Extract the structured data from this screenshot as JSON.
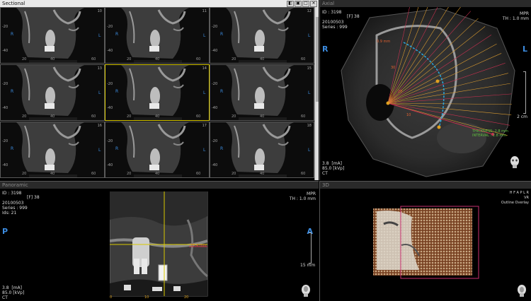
{
  "sectional": {
    "title": "Sectional",
    "win_buttons": [
      "◧",
      "▣",
      "□",
      "✕"
    ],
    "side_letter_r": "R",
    "side_letter_l": "L",
    "ticks_y": [
      "-20",
      "-40"
    ],
    "ticks_x": [
      "20",
      "40",
      "60"
    ],
    "cell_numbers": [
      "10",
      "11",
      "12",
      "13",
      "14",
      "15",
      "16",
      "17",
      "18"
    ]
  },
  "axial": {
    "title": "Axial",
    "id_line": "ID : 3198",
    "f_line": "[F] 38",
    "date": "20100503",
    "series": "Series : 999",
    "mode": "MPR",
    "th": "TH : 1.0 mm",
    "letter_r": "R",
    "letter_l": "L",
    "ma": "3.8  [mA]",
    "kvp": "85.0 [kVp]",
    "ct": "CT",
    "scale_label": "2 cm",
    "thickness": "THICKNESS: 2.8 mm",
    "interval": "INTERVAL : 2.8 mm",
    "measure": "0.9 mm",
    "arch_marks": [
      "30",
      "20",
      "10"
    ]
  },
  "panoramic": {
    "title": "Panoramic",
    "id_line": "ID : 3198",
    "f_line": "[F] 38",
    "date": "20100503",
    "series": "Series : 999",
    "ids": "Ids: 21",
    "mode": "MPR",
    "th": "TH : 1.0 mm",
    "letter_p": "P",
    "letter_a": "A",
    "ma": "3.8  [mA]",
    "kvp": "85.0 [kVp]",
    "ct": "CT",
    "scale_label": "15 mm",
    "ticks": [
      "0",
      "10",
      "20"
    ],
    "ruler_label": "27.4 mm"
  },
  "vr3d": {
    "title": "3D",
    "orient": "H F A P L R",
    "mode": "VR",
    "overlay": "Outline Overlay"
  },
  "colors": {
    "accent_blue": "#3c8ce0",
    "selection_yellow": "#d8c800",
    "cutline_red": "#c83050",
    "arch_blue": "#2aa8e0"
  }
}
